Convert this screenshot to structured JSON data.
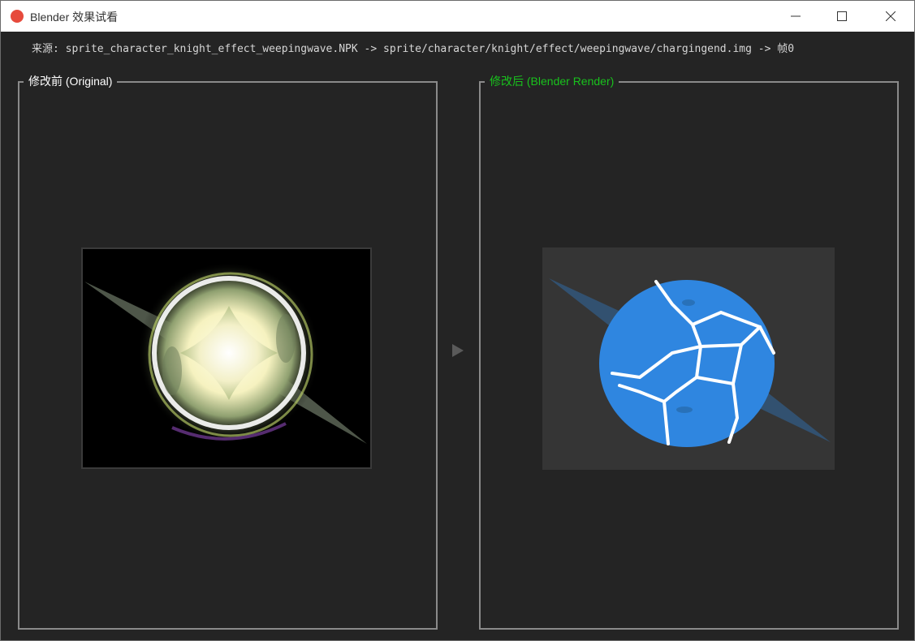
{
  "window": {
    "title": "Blender 效果试看",
    "icon": "blender-app-icon",
    "controls": [
      "minimize-icon",
      "maximize-icon",
      "close-icon"
    ]
  },
  "source": {
    "text": "来源: sprite_character_knight_effect_weepingwave.NPK -> sprite/character/knight/effect/weepingwave/chargingend.img -> 帧0"
  },
  "left_panel": {
    "label": "修改前 (Original)",
    "image": "original-effect-sprite"
  },
  "right_panel": {
    "label": "修改后 (Blender Render)",
    "label_color": "#19c21d",
    "image": "blender-render-sprite"
  },
  "arrow": {
    "icon": "play-arrow-icon"
  },
  "colors": {
    "background": "#242424",
    "panel_border": "#8a8a8a",
    "accent_green": "#19c21d",
    "render_blue": "#2f86e0"
  }
}
